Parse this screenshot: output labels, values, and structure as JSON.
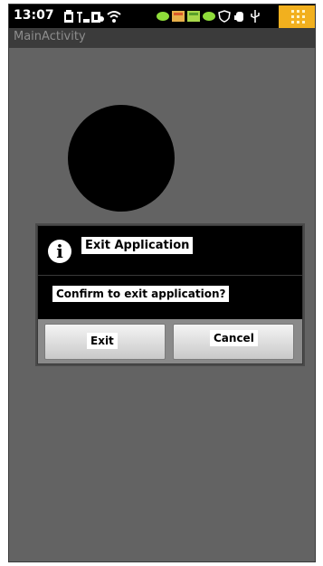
{
  "status_bar": {
    "time": "13:07",
    "icons": [
      "battery-icon",
      "signal-icon",
      "sync-icon",
      "wifi-icon",
      "message-icon",
      "image-icon",
      "image-icon",
      "message-icon",
      "shield-icon",
      "hand-icon",
      "usb-icon",
      "grid-icon"
    ],
    "accent": "#f2b01e"
  },
  "title_bar": {
    "title": "MainActivity"
  },
  "dialog": {
    "title": "Exit Application",
    "message": "Confirm to exit application?",
    "icon": "info-icon",
    "buttons": {
      "exit_label": "Exit",
      "cancel_label": "Cancel"
    }
  },
  "colors": {
    "background": "#636363",
    "dialog_frame": "#8a8a8a",
    "circle": "#000000"
  }
}
